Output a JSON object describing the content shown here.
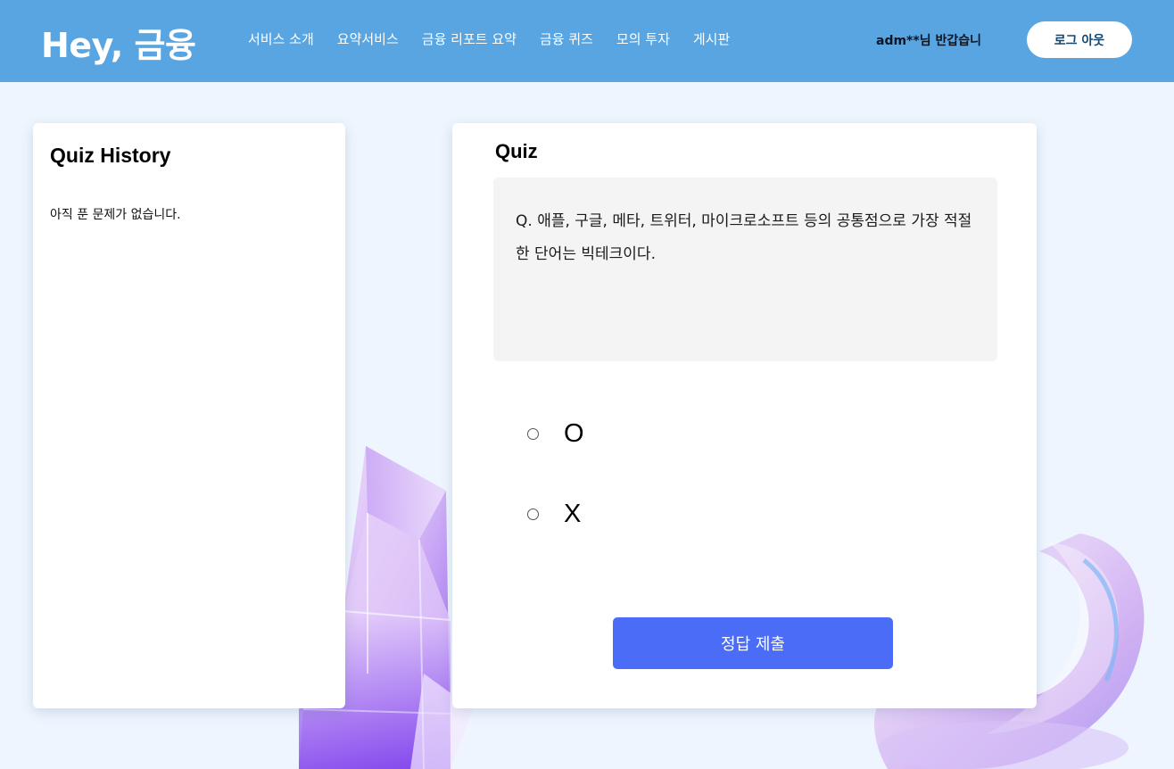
{
  "header": {
    "logo": "Hey, 금융",
    "nav": [
      {
        "label": "서비스 소개"
      },
      {
        "label": "요약서비스"
      },
      {
        "label": "금융 리포트 요약"
      },
      {
        "label": "금융 퀴즈"
      },
      {
        "label": "모의 투자"
      },
      {
        "label": "게시판"
      }
    ],
    "greeting": "adm**님 반갑습니",
    "logout_label": "로그 아웃"
  },
  "history": {
    "title": "Quiz History",
    "empty_message": "아직 푼 문제가 없습니다."
  },
  "quiz": {
    "title": "Quiz",
    "question": "Q. 애플, 구글, 메타, 트위터, 마이크로소프트 등의 공통점으로 가장 적절한 단어는 빅테크이다.",
    "options": [
      {
        "label": "O",
        "selected": false
      },
      {
        "label": "X",
        "selected": false
      }
    ],
    "submit_label": "정답 제출"
  },
  "colors": {
    "header_bg": "#58a5e1",
    "page_bg": "#eef5fe",
    "submit_bg": "#4a6cf7",
    "question_bg": "#f4f4f4"
  },
  "icons": {
    "decoration_left": "glass-cube-illustration",
    "decoration_right": "glass-ring-illustration"
  }
}
